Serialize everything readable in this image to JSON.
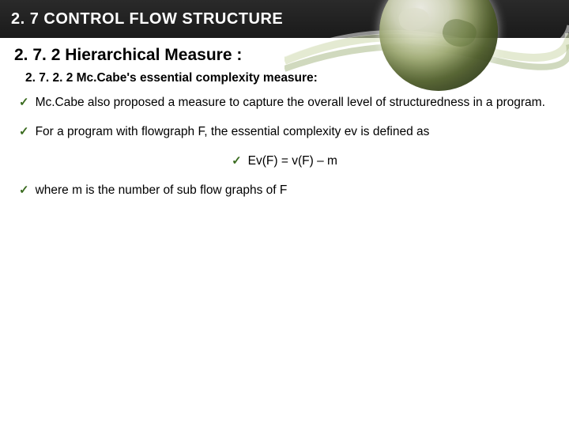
{
  "header": {
    "title": "2. 7 CONTROL FLOW STRUCTURE"
  },
  "section": {
    "heading": "2. 7. 2 Hierarchical Measure :",
    "subheading": "2. 7. 2. 2  Mc.Cabe's essential complexity measure:"
  },
  "bullets": {
    "b1": "Mc.Cabe also proposed a measure to capture the overall level of structuredness in a program.",
    "b2": "For a program with flowgraph F, the essential complexity  ev is defined as",
    "b3": "Ev(F) = v(F) – m",
    "b4": "where m is the number of sub flow graphs of F"
  }
}
